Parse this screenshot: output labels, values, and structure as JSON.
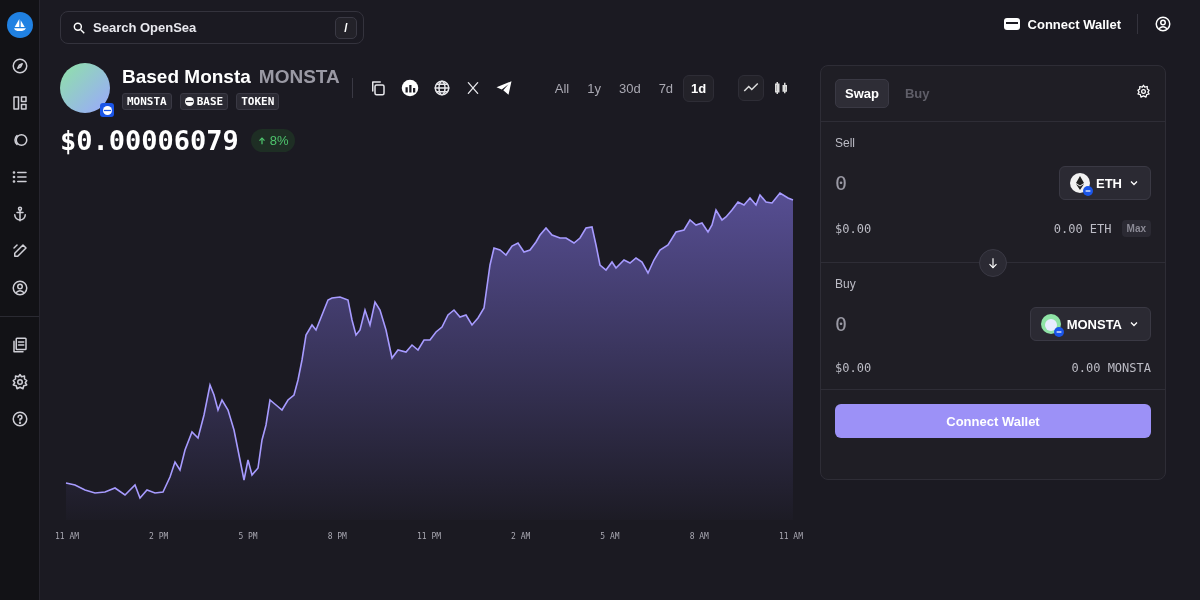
{
  "search": {
    "placeholder": "Search OpenSea",
    "shortcut": "/"
  },
  "header": {
    "connect_wallet": "Connect Wallet"
  },
  "token": {
    "name": "Based Monsta",
    "symbol": "MONSTA",
    "tags": [
      {
        "label": "MONSTA",
        "kind": "plain"
      },
      {
        "label": "BASE",
        "kind": "chain"
      },
      {
        "label": "TOKEN",
        "kind": "plain"
      }
    ],
    "price": "$0.00006079",
    "change": "8%"
  },
  "ranges": [
    {
      "label": "All",
      "selected": false
    },
    {
      "label": "1y",
      "selected": false
    },
    {
      "label": "30d",
      "selected": false
    },
    {
      "label": "7d",
      "selected": false
    },
    {
      "label": "1d",
      "selected": true
    }
  ],
  "chart_types": [
    {
      "kind": "line",
      "selected": true
    },
    {
      "kind": "candle",
      "selected": false
    }
  ],
  "chart": {
    "x_labels": [
      "11 AM",
      "2 PM",
      "5 PM",
      "8 PM",
      "11 PM",
      "2 AM",
      "5 AM",
      "8 AM",
      "11 AM"
    ]
  },
  "swap": {
    "tabs": [
      {
        "label": "Swap",
        "selected": true
      },
      {
        "label": "Buy",
        "selected": false
      }
    ],
    "sell": {
      "label": "Sell",
      "placeholder": "0",
      "token": "ETH",
      "usd": "$0.00",
      "balance": "0.00 ETH",
      "max": "Max"
    },
    "buy": {
      "label": "Buy",
      "placeholder": "0",
      "token": "MONSTA",
      "usd": "$0.00",
      "balance": "0.00 MONSTA"
    },
    "button": "Connect Wallet"
  }
}
